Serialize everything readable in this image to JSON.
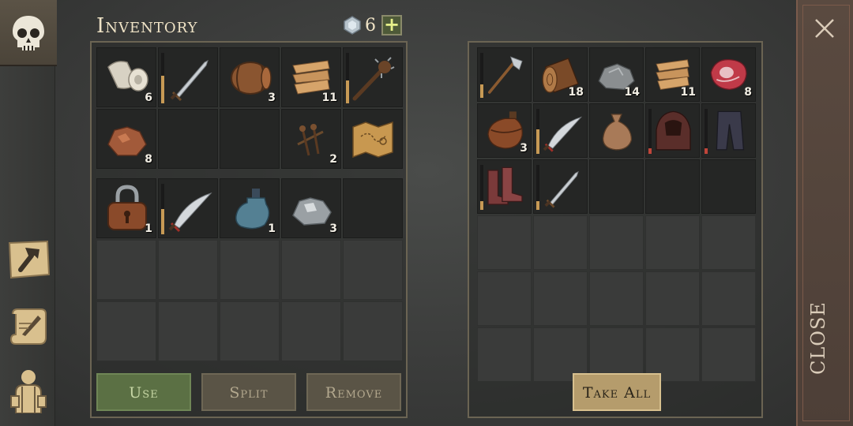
{
  "inventory": {
    "title": "Inventory",
    "gem_count": "6",
    "plus_label": "+",
    "rows": [
      [
        {
          "icon": "cloth-roll-icon",
          "qty": "6"
        },
        {
          "icon": "sword-icon",
          "qty": "",
          "durability": 0.55,
          "dura_color": "#c79a55"
        },
        {
          "icon": "barrel-icon",
          "qty": "3"
        },
        {
          "icon": "fabric-icon",
          "qty": "11"
        },
        {
          "icon": "spiked-club-icon",
          "qty": "",
          "durability": 0.45,
          "dura_color": "#c79a55"
        }
      ],
      [
        {
          "icon": "copper-ore-icon",
          "qty": "8"
        },
        {
          "icon": "",
          "qty": ""
        },
        {
          "icon": "",
          "qty": ""
        },
        {
          "icon": "nails-icon",
          "qty": "2"
        },
        {
          "icon": "treasure-map-icon",
          "qty": ""
        }
      ],
      [
        {
          "icon": "padlock-icon",
          "qty": "1"
        },
        {
          "icon": "scimitar-icon",
          "qty": "",
          "durability": 0.5,
          "dura_color": "#c79a55"
        },
        {
          "icon": "bottle-icon",
          "qty": "1"
        },
        {
          "icon": "iron-ore-icon",
          "qty": "3"
        },
        {
          "icon": "",
          "qty": ""
        }
      ]
    ],
    "empty_rows": 2
  },
  "loot": {
    "rows": [
      [
        {
          "icon": "axe-icon",
          "qty": "",
          "durability": 0.3,
          "dura_color": "#c79a55"
        },
        {
          "icon": "log-icon",
          "qty": "18"
        },
        {
          "icon": "stone-icon",
          "qty": "14"
        },
        {
          "icon": "fabric-icon",
          "qty": "11"
        },
        {
          "icon": "raw-meat-icon",
          "qty": "8"
        }
      ],
      [
        {
          "icon": "flask-icon",
          "qty": "3"
        },
        {
          "icon": "scimitar-icon",
          "qty": "",
          "durability": 0.55,
          "dura_color": "#c79a55"
        },
        {
          "icon": "sack-icon",
          "qty": ""
        },
        {
          "icon": "hood-icon",
          "qty": "",
          "durability": 0.12,
          "dura_color": "#c0453a"
        },
        {
          "icon": "pants-icon",
          "qty": "",
          "durability": 0.12,
          "dura_color": "#c0453a"
        }
      ],
      [
        {
          "icon": "boots-icon",
          "qty": "",
          "durability": 0.2,
          "dura_color": "#c79a55"
        },
        {
          "icon": "sword-icon",
          "qty": "",
          "durability": 0.2,
          "dura_color": "#c79a55"
        },
        {
          "icon": "",
          "qty": ""
        },
        {
          "icon": "",
          "qty": ""
        },
        {
          "icon": "",
          "qty": ""
        }
      ]
    ],
    "empty_rows": 3
  },
  "buttons": {
    "use": "Use",
    "split": "Split",
    "remove": "Remove",
    "take_all": "Take All",
    "close": "CLOSE"
  },
  "sidebar": {
    "items": [
      "skull-icon",
      "crafting-hammer-icon",
      "journal-scroll-icon",
      "character-icon"
    ]
  }
}
